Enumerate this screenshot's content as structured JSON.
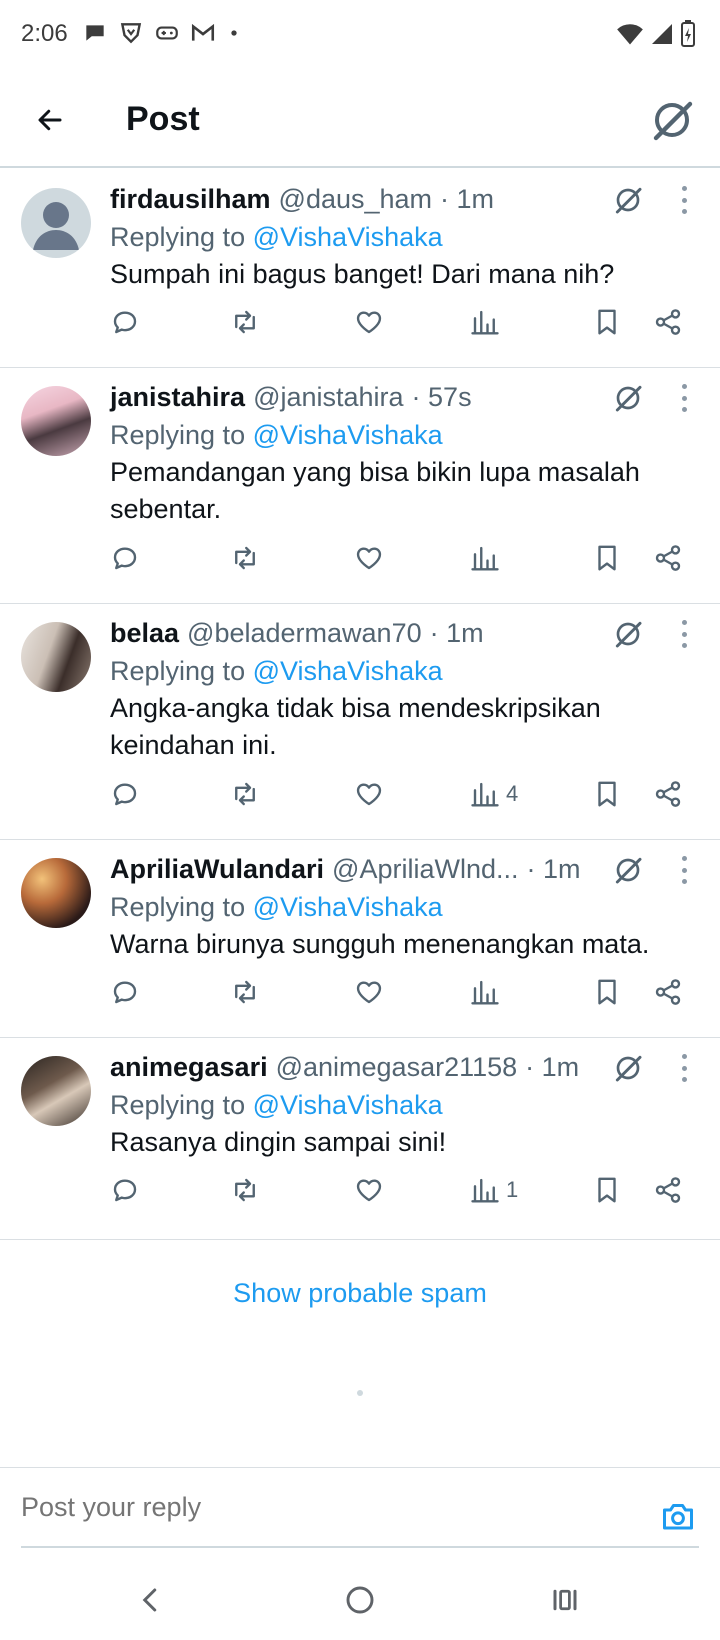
{
  "status_bar": {
    "time": "2:06",
    "left_icons": [
      "chat-bubble-icon",
      "brave-icon",
      "gamepad-icon",
      "gmail-icon",
      "dot-icon"
    ],
    "right_icons": [
      "wifi-icon",
      "signal-icon",
      "battery-charging-icon"
    ]
  },
  "header": {
    "title": "Post",
    "back_icon": "arrow-left-icon",
    "right_icon": "grok-icon"
  },
  "replies": [
    {
      "name": "firdausilham",
      "handle": "@daus_ham",
      "time": "· 1m",
      "replying_prefix": "Replying to",
      "replying_to": "@VishaVishaka",
      "text": "Sumpah ini bagus banget! Dari mana nih?",
      "views": "",
      "avatar": "default"
    },
    {
      "name": "janistahira",
      "handle": "@janistahira",
      "time": "· 57s",
      "replying_prefix": "Replying to",
      "replying_to": "@VishaVishaka",
      "text": "Pemandangan yang bisa bikin lupa masalah sebentar.",
      "views": "",
      "avatar": "photo"
    },
    {
      "name": "belaa",
      "handle": "@beladermawan70",
      "time": "· 1m",
      "replying_prefix": "Replying to",
      "replying_to": "@VishaVishaka",
      "text": "Angka-angka tidak bisa mendeskripsikan keindahan ini.",
      "views": "4",
      "avatar": "photo"
    },
    {
      "name": "ApriliaWulandari",
      "handle": "@ApriliaWlnd...",
      "time": "· 1m",
      "replying_prefix": "Replying to",
      "replying_to": "@VishaVishaka",
      "text": "Warna birunya sungguh menenangkan mata.",
      "views": "",
      "avatar": "photo"
    },
    {
      "name": "animegasari",
      "handle": "@animegasar21158",
      "time": "· 1m",
      "replying_prefix": "Replying to",
      "replying_to": "@VishaVishaka",
      "text": "Rasanya dingin sampai sini!",
      "views": "1",
      "avatar": "photo"
    }
  ],
  "show_spam": "Show probable spam",
  "compose": {
    "placeholder": "Post your reply",
    "camera_icon": "camera-icon"
  },
  "colors": {
    "accent": "#1d9bf0",
    "text": "#0f1419",
    "muted": "#536471",
    "divider": "#dadfe3"
  }
}
